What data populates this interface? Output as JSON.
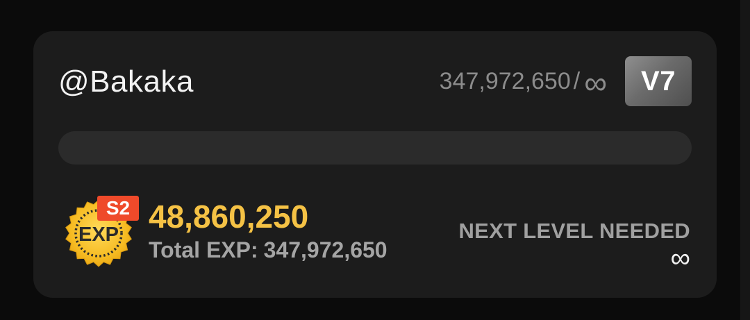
{
  "user": {
    "username": "@Bakaka"
  },
  "level": {
    "current_exp": "347,972,650",
    "separator": "/",
    "target": "∞",
    "vip_label": "V7",
    "progress_fraction": 0
  },
  "exp": {
    "season_badge": "S2",
    "icon_text": "EXP",
    "season_value": "48,860,250",
    "total_label": "Total EXP:",
    "total_value": "347,972,650"
  },
  "next_level": {
    "label": "NEXT LEVEL NEEDED",
    "value": "∞"
  },
  "colors": {
    "card_bg": "#1c1c1c",
    "exp_gold": "#f5c245",
    "season_badge": "#ef4a2a",
    "muted_text": "#8c8c8c"
  },
  "icons": {
    "exp_icon": "exp-seal-icon",
    "infinity": "infinity-symbol"
  }
}
